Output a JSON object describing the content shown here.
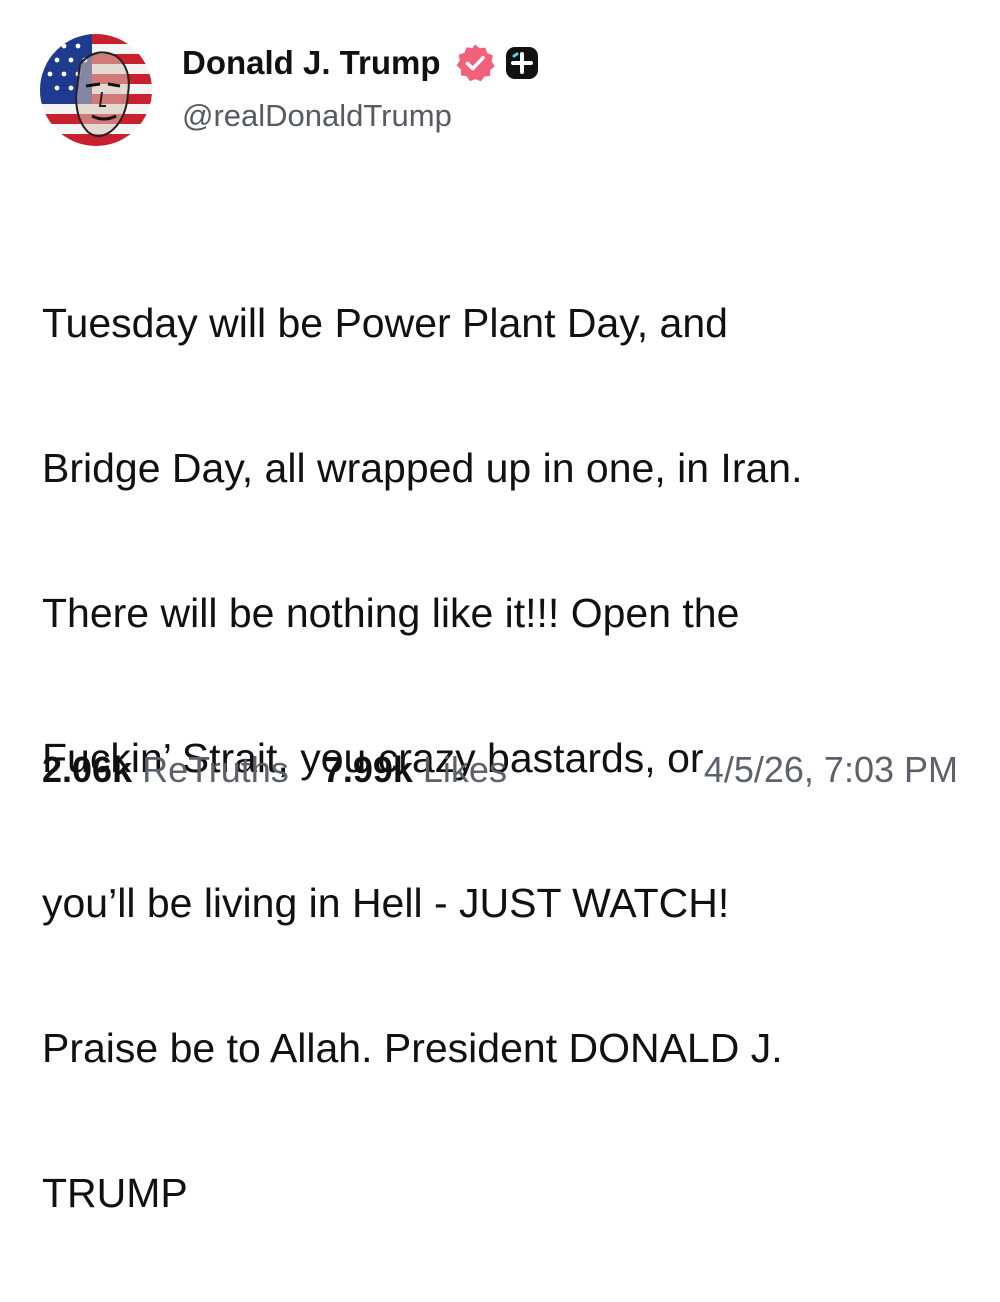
{
  "author": {
    "name": "Donald J. Trump",
    "handle": "@realDonaldTrump",
    "verified_color": "#f2617a",
    "plus_badge_color": "#111111"
  },
  "post": {
    "lines": [
      "Tuesday will be Power Plant Day, and",
      "Bridge Day, all wrapped up in one, in Iran.",
      "There will be nothing like it!!! Open the",
      "Fuckin’ Strait, you crazy bastards, or",
      "you’ll be living in Hell - JUST WATCH!",
      "Praise be to Allah. President DONALD J.",
      "TRUMP"
    ]
  },
  "stats": {
    "retruths_count": "2.06k",
    "retruths_label": "ReTruths",
    "likes_count": "7.99k",
    "likes_label": "Likes",
    "timestamp": "4/5/26, 7:03 PM"
  },
  "icons": {
    "avatar": "profile-picture-flag",
    "verified": "verified-badge-icon",
    "plus": "plus-badge-icon"
  }
}
